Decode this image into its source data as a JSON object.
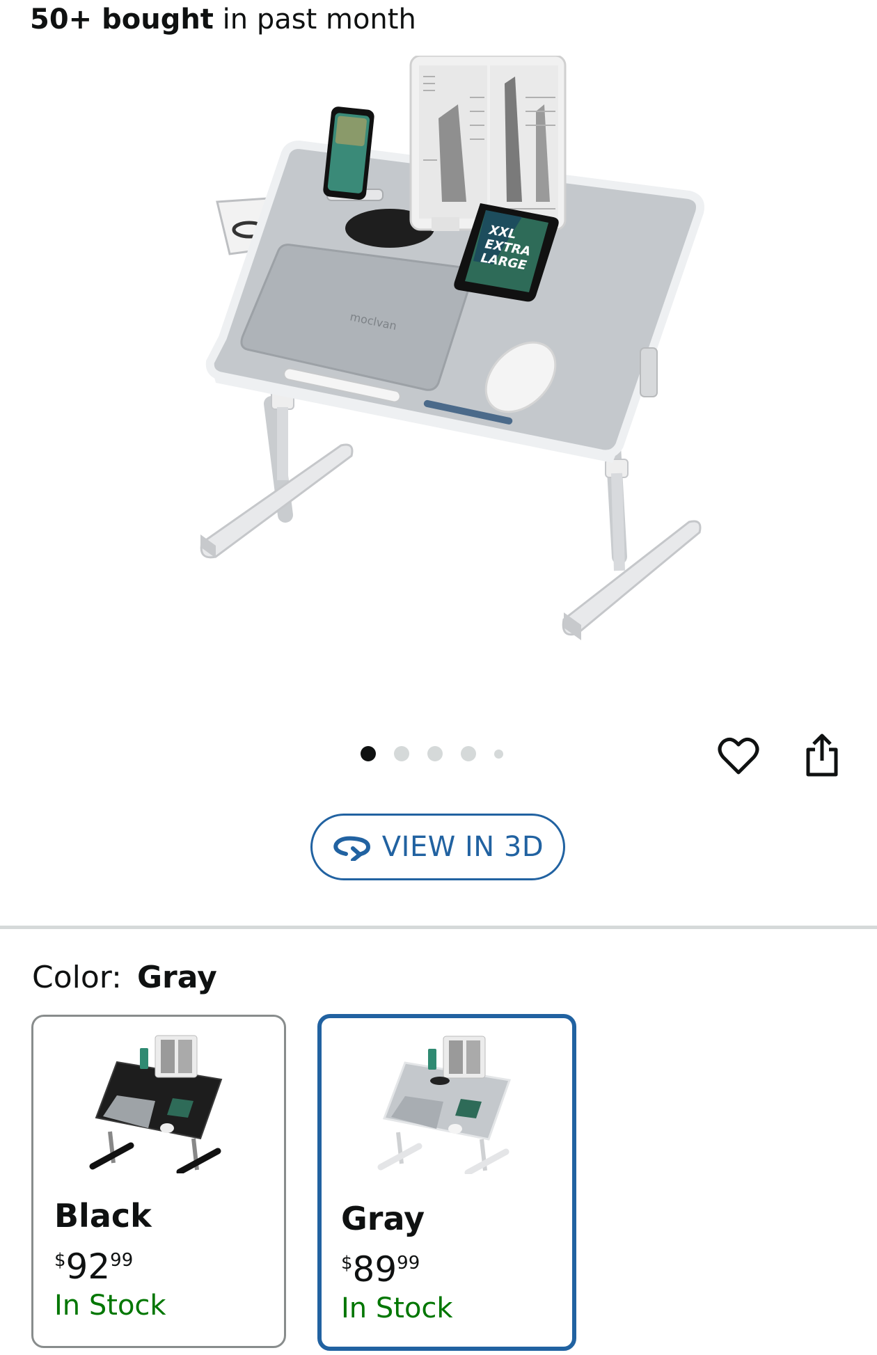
{
  "social_proof": {
    "count": "50+ bought",
    "suffix": " in past month"
  },
  "gallery": {
    "image_alt": "Gray laptop bed tray desk with phone, book stand, tablet and drawer",
    "tablet_text": [
      "XXL",
      "EXTRA",
      "LARGE"
    ],
    "image_count": 5,
    "active_index": 0,
    "wishlist_icon": "heart-icon",
    "share_icon": "share-icon"
  },
  "view_3d": {
    "label": "VIEW IN 3D",
    "icon": "rotate-3d-icon",
    "color": "#2162a1"
  },
  "color_selector": {
    "label": "Color:",
    "selected": "Gray",
    "options": [
      {
        "name": "Black",
        "currency": "$",
        "whole": "92",
        "cents": "99",
        "availability": "In Stock"
      },
      {
        "name": "Gray",
        "currency": "$",
        "whole": "89",
        "cents": "99",
        "availability": "In Stock"
      }
    ]
  },
  "colors": {
    "accent": "#2162a1",
    "in_stock": "#007600",
    "text": "#0f1111",
    "divider": "#d5d9d9"
  }
}
